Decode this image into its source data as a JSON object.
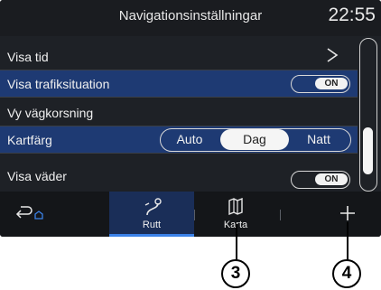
{
  "header": {
    "title": "Navigationsinställningar",
    "clock": "22:55"
  },
  "settings": [
    {
      "label": "Visa tid"
    },
    {
      "label": "Visa trafiksituation",
      "toggle": "ON"
    },
    {
      "label": "Vy vägkorsning"
    },
    {
      "label": "Kartfärg",
      "options": [
        "Auto",
        "Dag",
        "Natt"
      ],
      "selected": "Dag"
    },
    {
      "label": "Visa väder",
      "toggle": "ON"
    }
  ],
  "tabs": [
    {
      "icon": "back-icon"
    },
    {
      "label": "Rutt",
      "icon": "route-icon",
      "active": true
    },
    {
      "label": "Karta",
      "icon": "map-icon"
    },
    {
      "icon": "plus-icon"
    }
  ],
  "callouts": [
    "3",
    "4"
  ],
  "colors": {
    "highlight": "#1e3a73",
    "accent": "#3b82e8",
    "background": "#1e2126"
  }
}
